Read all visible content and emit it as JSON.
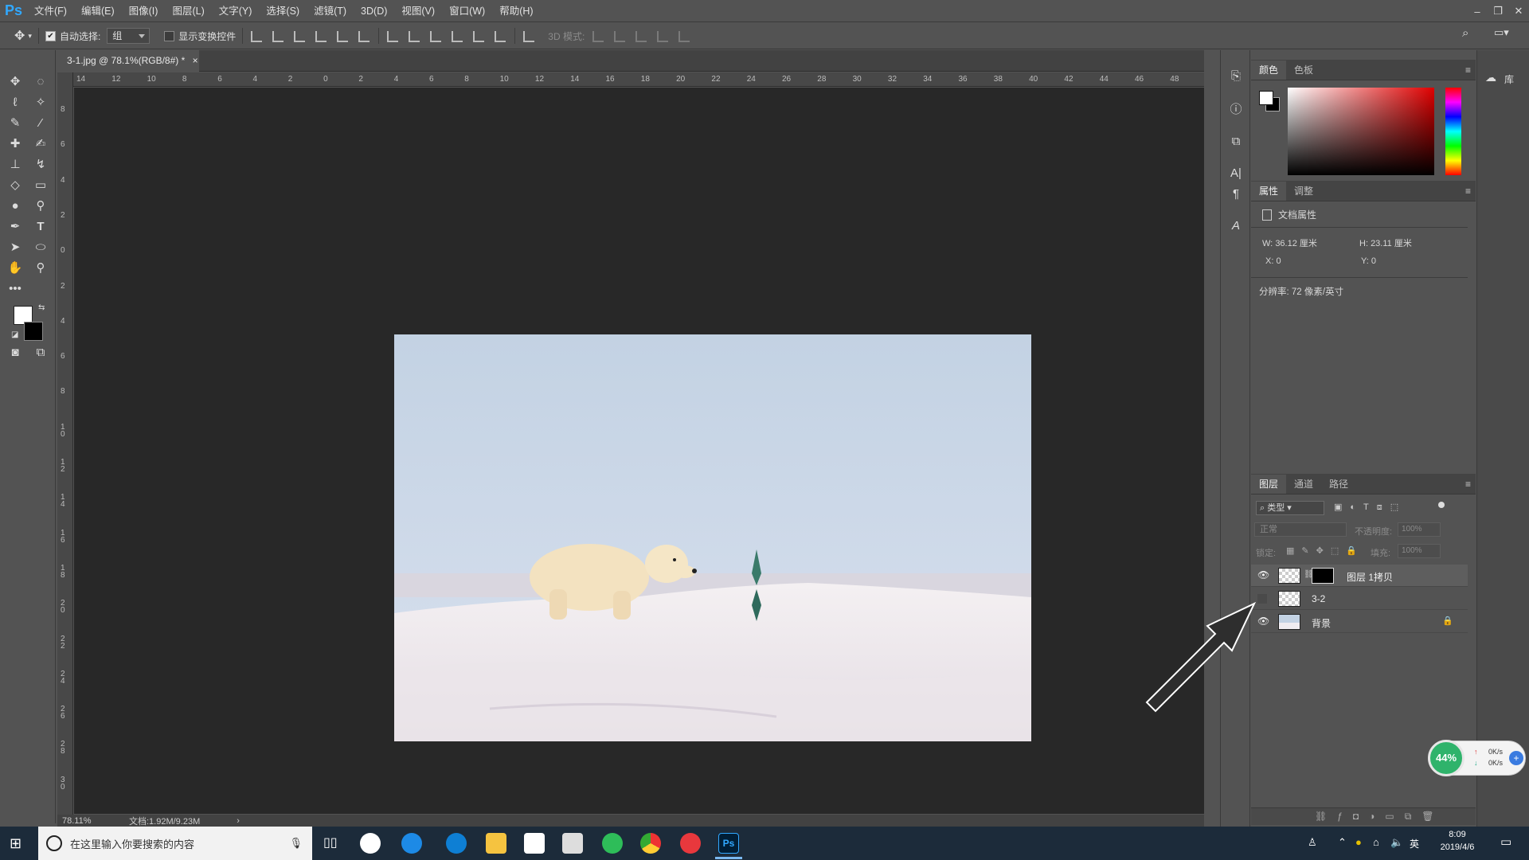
{
  "app": {
    "logo": "Ps"
  },
  "menubar": {
    "items": [
      "文件(F)",
      "编辑(E)",
      "图像(I)",
      "图层(L)",
      "文字(Y)",
      "选择(S)",
      "滤镜(T)",
      "3D(D)",
      "视图(V)",
      "窗口(W)",
      "帮助(H)"
    ]
  },
  "window_controls": {
    "minimize": "–",
    "restore": "❐",
    "close": "✕"
  },
  "options": {
    "auto_select_label": "自动选择:",
    "auto_select_value": "组",
    "show_transform_label": "显示变换控件",
    "mode_3d_label": "3D 模式:"
  },
  "document": {
    "tab_title": "3-1.jpg @ 78.1%(RGB/8#) *",
    "close": "×",
    "zoom": "78.11%",
    "doc_size": "文档:1.92M/9.23M",
    "status_arrow": "›"
  },
  "ruler": {
    "h_labels": [
      "14",
      "12",
      "10",
      "8",
      "6",
      "4",
      "2",
      "0",
      "2",
      "4",
      "6",
      "8",
      "10",
      "12",
      "14",
      "16",
      "18",
      "20",
      "22",
      "24",
      "26",
      "28",
      "30",
      "32",
      "34",
      "36",
      "38",
      "40",
      "42",
      "44",
      "46",
      "48"
    ],
    "v_labels": [
      "8",
      "6",
      "4",
      "2",
      "0",
      "2",
      "4",
      "6",
      "8",
      "10",
      "12",
      "14",
      "16",
      "18",
      "20",
      "22",
      "24",
      "26",
      "28",
      "30"
    ]
  },
  "color_panel": {
    "tabs": [
      "颜色",
      "色板"
    ],
    "active": 0,
    "hue_color": "#e00000"
  },
  "properties_panel": {
    "tabs": [
      "属性",
      "调整"
    ],
    "header": "文档属性",
    "w_label": "W:",
    "w_value": "36.12 厘米",
    "h_label": "H:",
    "h_value": "23.11 厘米",
    "x_label": "X:",
    "x_value": "0",
    "y_label": "Y:",
    "y_value": "0",
    "resolution": "分辨率: 72 像素/英寸"
  },
  "layers_panel": {
    "tabs": [
      "图层",
      "通道",
      "路径"
    ],
    "filter_kind": "类型",
    "blend_mode": "正常",
    "opacity_label": "不透明度:",
    "opacity_value": "100%",
    "lock_label": "锁定:",
    "fill_label": "填充:",
    "fill_value": "100%",
    "layers": [
      {
        "name": "图层 1拷贝",
        "visible": true
      },
      {
        "name": "3-2",
        "visible": false
      },
      {
        "name": "背景",
        "visible": true,
        "locked": true
      }
    ]
  },
  "widget": {
    "percent": "44%",
    "up": "0K/s",
    "down": "0K/s"
  },
  "taskbar": {
    "search_placeholder": "在这里输入你要搜索的内容",
    "ime": "英",
    "time": "8:09",
    "date": "2019/4/6",
    "ps_label": "Ps"
  }
}
